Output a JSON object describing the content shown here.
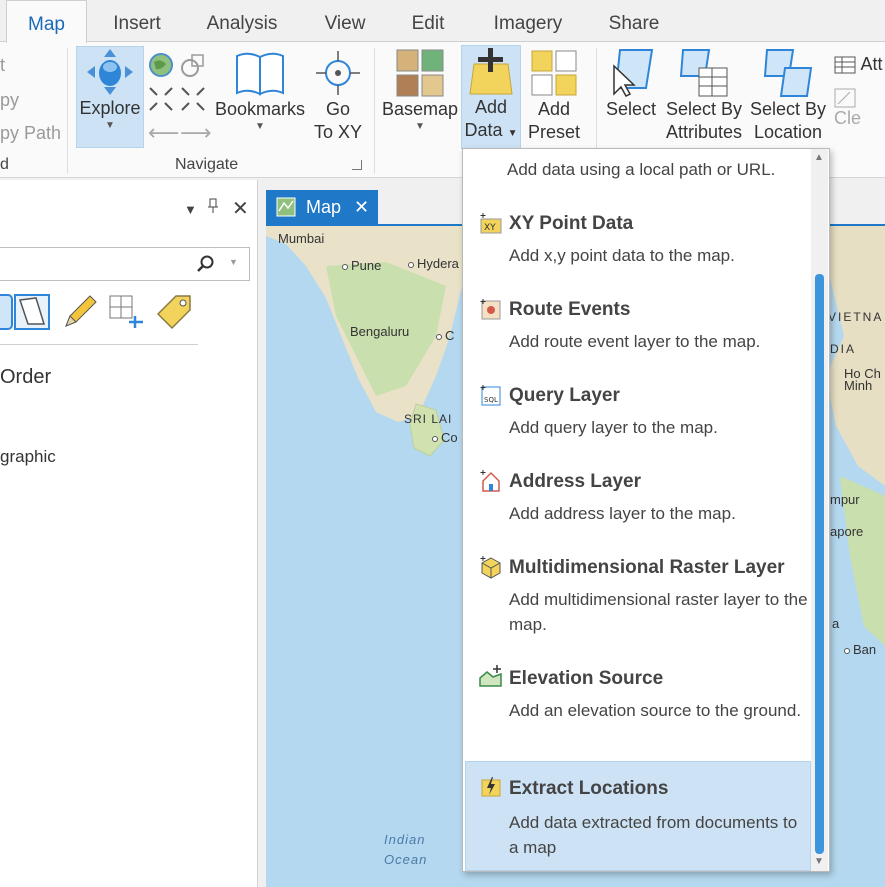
{
  "tabs": [
    "Map",
    "Insert",
    "Analysis",
    "View",
    "Edit",
    "Imagery",
    "Share"
  ],
  "ribbon": {
    "left_partial": [
      "t",
      "py",
      "py Path",
      "d"
    ],
    "explore": "Explore",
    "bookmarks": "Bookmarks",
    "goto_line1": "Go",
    "goto_line2": "To XY",
    "navigate_group": "Navigate",
    "basemap": "Basemap",
    "add_data_line1": "Add",
    "add_data_line2": "Data",
    "add_preset_line1": "Add",
    "add_preset_line2": "Preset",
    "select": "Select",
    "select_by_attr_line1": "Select By",
    "select_by_attr_line2": "Attributes",
    "select_by_loc_line1": "Select By",
    "select_by_loc_line2": "Location",
    "right_partial_1": "Att",
    "right_partial_2": "Cle"
  },
  "contents": {
    "drawing_order": "Order",
    "layer": "graphic"
  },
  "map": {
    "tab_label": "Map",
    "labels": {
      "mumbai": "Mumbai",
      "pune": "Pune",
      "hyderabad": "Hydera",
      "bengaluru": "Bengaluru",
      "chennai": "C",
      "sri_lanka": "SRI LAI",
      "colombo": "Co",
      "vietnam": "VIETNA",
      "dia": "DIA",
      "hcmc1": "Ho Ch",
      "hcmc2": "Minh",
      "kl": "mpur",
      "sg": "apore",
      "bangkok": "Ban",
      "a": "a",
      "ocean1": "Indian",
      "ocean2": "Ocean"
    }
  },
  "dropdown": {
    "top_desc": "Add data using a local path or URL.",
    "items": [
      {
        "title": "XY Point Data",
        "desc": "Add x,y point data to the map."
      },
      {
        "title": "Route Events",
        "desc": "Add route event layer to the map."
      },
      {
        "title": "Query Layer",
        "desc": "Add query layer to the map."
      },
      {
        "title": "Address Layer",
        "desc": "Add address layer to the map."
      },
      {
        "title": "Multidimensional Raster Layer",
        "desc": "Add multidimensional raster layer to the map."
      },
      {
        "title": "Elevation Source",
        "desc": "Add an elevation source to the ground."
      },
      {
        "title": "Extract Locations",
        "desc": "Add data extracted from documents to a map"
      }
    ]
  },
  "colors": {
    "accent": "#1a6bb8",
    "selected_button": "#cde3f5",
    "map_tab": "#1f78c8"
  }
}
